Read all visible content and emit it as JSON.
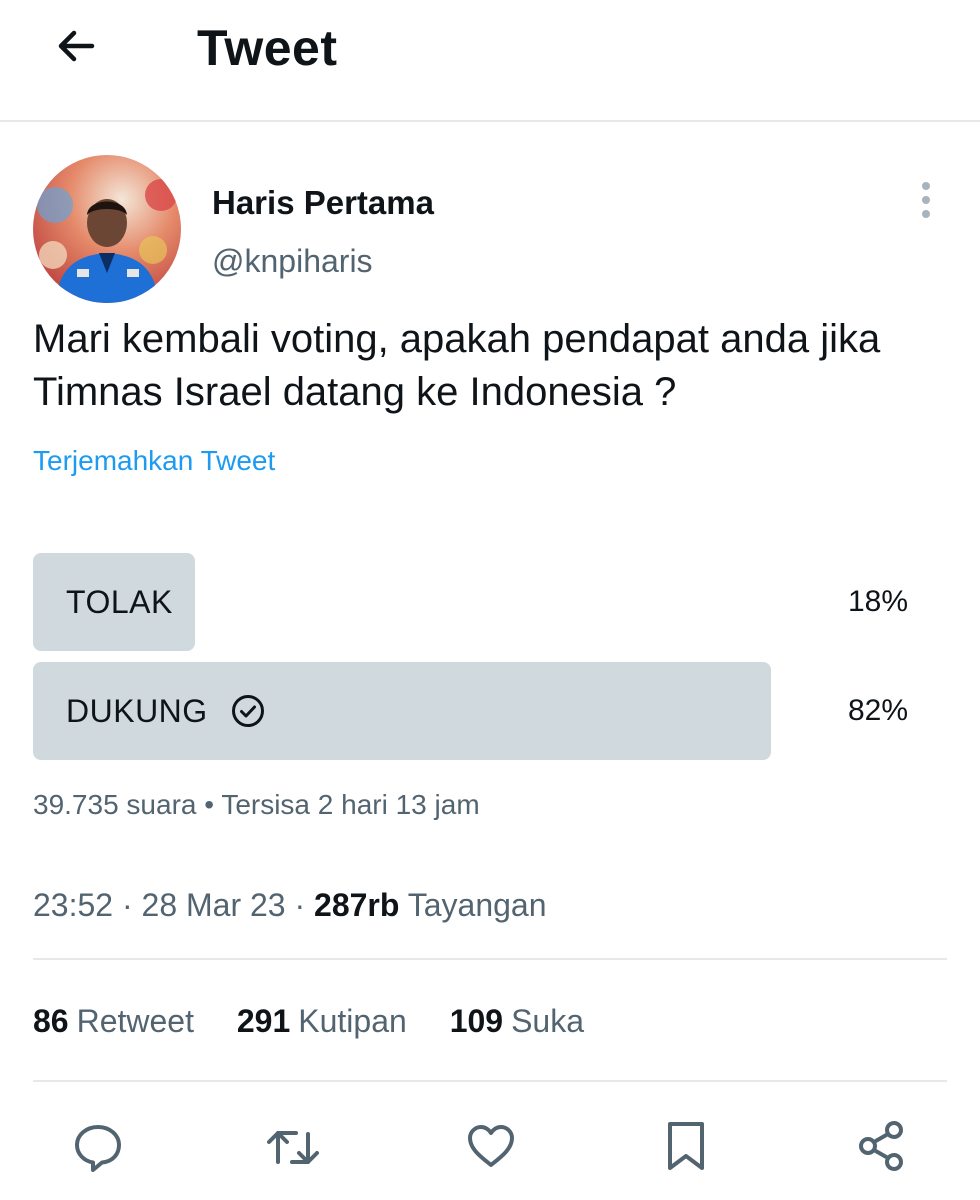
{
  "header": {
    "title": "Tweet",
    "back_icon": "arrow-left-icon"
  },
  "author": {
    "name": "Haris Pertama",
    "handle": "@knpiharis"
  },
  "tweet": {
    "text": "Mari kembali voting, apakah pendapat anda jika Timnas Israel datang ke Indonesia ?",
    "translate_label": "Terjemahkan Tweet"
  },
  "poll": {
    "options": [
      {
        "label": "TOLAK",
        "percent": "18%",
        "fraction": 0.18,
        "selected": false
      },
      {
        "label": "DUKUNG",
        "percent": "82%",
        "fraction": 0.82,
        "selected": true
      }
    ],
    "meta": "39.735 suara • Tersisa 2 hari 13 jam"
  },
  "timestamp": {
    "time": "23:52 · 28 Mar 23 · ",
    "views_count": "287rb",
    "views_label": " Tayangan"
  },
  "stats": {
    "retweets_count": "86",
    "retweets_label": "Retweet",
    "quotes_count": "291",
    "quotes_label": "Kutipan",
    "likes_count": "109",
    "likes_label": "Suka"
  },
  "actions": [
    "reply-icon",
    "retweet-icon",
    "like-icon",
    "bookmark-icon",
    "share-icon"
  ],
  "colors": {
    "accent": "#1d9bf0",
    "poll_bar": "#cfd9de",
    "muted_text": "#536471",
    "text": "#0f1419"
  }
}
